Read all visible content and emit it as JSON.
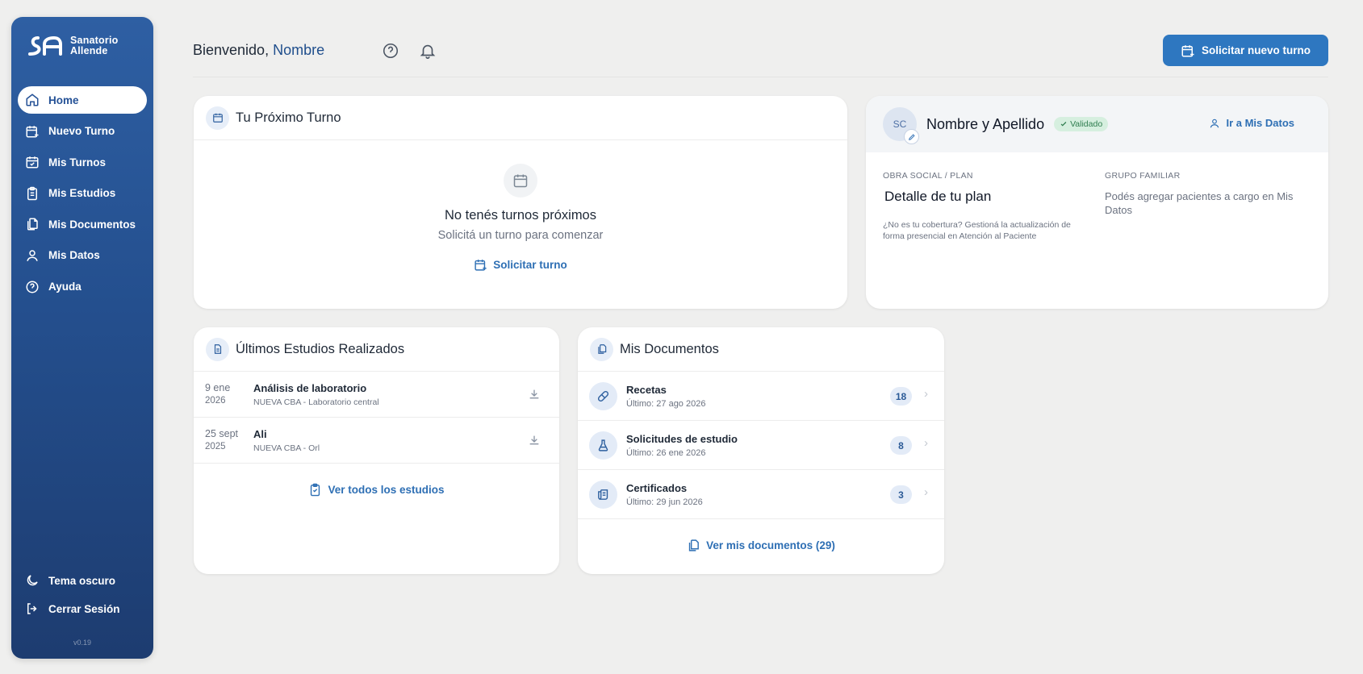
{
  "brand": {
    "name_line1": "Sanatorio",
    "name_line2": "Allende",
    "version": "v0.19"
  },
  "sidebar": {
    "items": [
      {
        "label": "Home",
        "icon": "home-icon"
      },
      {
        "label": "Nuevo Turno",
        "icon": "calendar-plus-icon"
      },
      {
        "label": "Mis Turnos",
        "icon": "calendar-check-icon"
      },
      {
        "label": "Mis Estudios",
        "icon": "clipboard-list-icon"
      },
      {
        "label": "Mis Documentos",
        "icon": "files-icon"
      },
      {
        "label": "Mis Datos",
        "icon": "user-icon"
      },
      {
        "label": "Ayuda",
        "icon": "help-circle-icon"
      }
    ],
    "bottom": [
      {
        "label": "Tema oscuro",
        "icon": "moon-icon"
      },
      {
        "label": "Cerrar Sesión",
        "icon": "logout-icon"
      }
    ]
  },
  "header": {
    "welcome": "Bienvenido,",
    "name": "Nombre",
    "cta": "Solicitar nuevo turno"
  },
  "next_appointment": {
    "title": "Tu Próximo Turno",
    "empty_title": "No tenés turnos próximos",
    "empty_subtitle": "Solicitá un turno para comenzar",
    "link": "Solicitar turno"
  },
  "profile": {
    "initials": "SC",
    "name": "Nombre y Apellido",
    "validated": "Validado",
    "link": "Ir a Mis Datos",
    "plan_label": "OBRA SOCIAL / PLAN",
    "plan_value": "Detalle de tu plan",
    "plan_note": "¿No es tu cobertura? Gestioná la actualización de forma presencial en Atención al Paciente",
    "family_label": "GRUPO FAMILIAR",
    "family_text": "Podés agregar pacientes a cargo en Mis Datos"
  },
  "studies": {
    "title": "Últimos Estudios Realizados",
    "link": "Ver todos los estudios",
    "rows": [
      {
        "day": "9 ene",
        "year": "2026",
        "name": "Análisis de laboratorio",
        "place": "NUEVA CBA - Laboratorio central"
      },
      {
        "day": "25 sept",
        "year": "2025",
        "name": "Ali",
        "place": "NUEVA CBA - Orl"
      }
    ]
  },
  "documents": {
    "title": "Mis Documentos",
    "link": "Ver mis documentos (29)",
    "rows": [
      {
        "name": "Recetas",
        "last": "Último: 27 ago 2026",
        "count": "18",
        "icon": "pill-icon"
      },
      {
        "name": "Solicitudes de estudio",
        "last": "Último: 26 ene 2026",
        "count": "8",
        "icon": "flask-icon"
      },
      {
        "name": "Certificados",
        "last": "Último: 29 jun 2026",
        "count": "3",
        "icon": "scroll-icon"
      }
    ]
  },
  "colors": {
    "primary": "#2e77c0",
    "sidebar": "#244f8e",
    "validated_bg": "#d6efdf",
    "validated_text": "#2f7d4f"
  }
}
